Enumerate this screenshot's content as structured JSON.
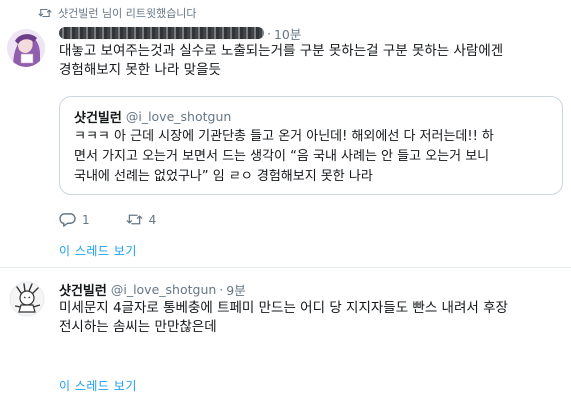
{
  "tweet1": {
    "retweet_context": "샷건빌런 님이 리트윗했습니다",
    "time": "10분",
    "text_lines": [
      "대놓고 보여주는것과 실수로 노출되는거를 구분 못하는걸 구분 못하는 사람에겐",
      "경험해보지 못한 나라 맞을듯"
    ],
    "quote": {
      "name": "샷건빌런",
      "handle": "@i_love_shotgun",
      "text_lines": [
        "ㅋㅋㅋ 아 근데 시장에 기관단총 들고 온거 아닌데! 해외에선 다 저러는데!! 하",
        "면서 가지고 오는거 보면서 드는 생각이 “음 국내 사례는 안 들고 오는거 보니",
        "국내에 선례는 없었구나” 임 ㄹㅇ 경험해보지 못한 나라"
      ]
    },
    "actions": {
      "reply_count": "1",
      "retweet_count": "4"
    },
    "thread_link": "이 스레드 보기"
  },
  "tweet2": {
    "name": "샷건빌런",
    "handle": "@i_love_shotgun",
    "dot": "·",
    "time": "9분",
    "text_lines": [
      "미세문지 4글자로 통베충에 트페미 만드는 어디 당 지지자들도 빤스 내려서 후장",
      "전시하는 솜씨는 만만찮은데"
    ],
    "thread_link": "이 스레드 보기"
  },
  "colors": {
    "link": "#1da1f2",
    "secondary": "#657786",
    "divider": "#e6ecf0"
  }
}
